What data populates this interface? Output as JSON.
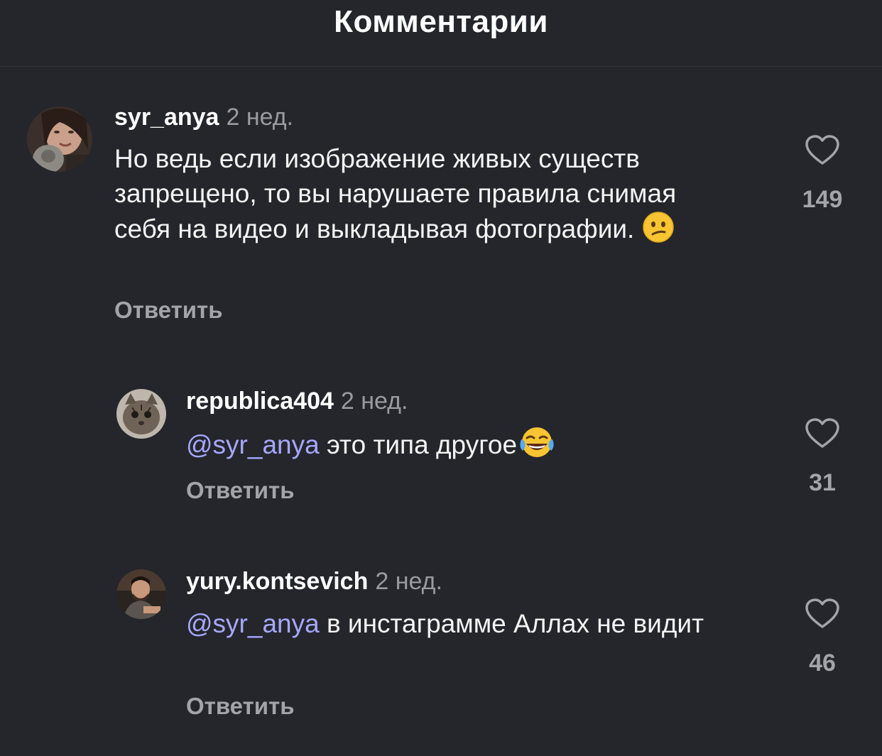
{
  "header": {
    "title": "Комментарии"
  },
  "comments": [
    {
      "username": "syr_anya",
      "time": "2 нед.",
      "text": "Но ведь если изображение живых существ запрещено, то вы нарушаете правила снимая себя на видео и выкладывая фотографии.",
      "emoji": "confused-face",
      "reply": "Ответить",
      "likes": "149"
    },
    {
      "username": "republica404",
      "time": "2 нед.",
      "mention": "@syr_anya",
      "text": "это типа другое",
      "emoji": "tears-of-joy",
      "reply": "Ответить",
      "likes": "31"
    },
    {
      "username": "yury.kontsevich",
      "time": "2 нед.",
      "mention": "@syr_anya",
      "text": "в инстаграмме Аллах не видит",
      "reply": "Ответить",
      "likes": "46"
    }
  ]
}
